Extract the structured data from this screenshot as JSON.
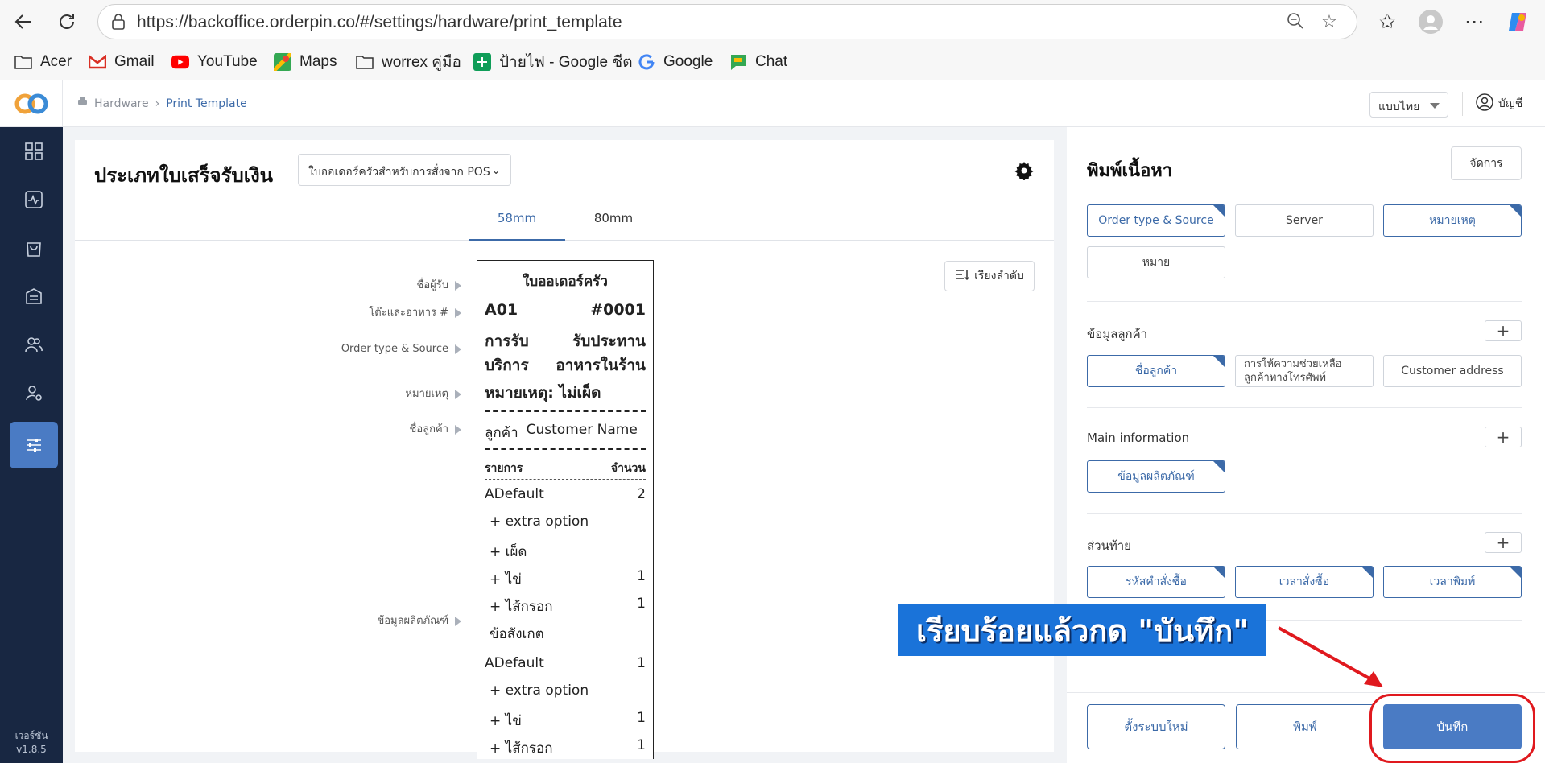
{
  "browser": {
    "url": "https://backoffice.orderpin.co/#/settings/hardware/print_template",
    "bookmarks": [
      "Acer",
      "Gmail",
      "YouTube",
      "Maps",
      "worrex คู่มือ",
      "ป้ายไฟ - Google ชีต",
      "Google",
      "Chat"
    ]
  },
  "header": {
    "breadcrumb": [
      "Hardware",
      "Print Template"
    ],
    "language": "แบบไทย",
    "account": "บัญชี"
  },
  "sidebar": {
    "icons": [
      "dashboard-icon",
      "activity-icon",
      "shopping-bag-icon",
      "store-icon",
      "users-icon",
      "user-settings-icon",
      "sliders-icon"
    ],
    "version_label": "เวอร์ชัน",
    "version": "v1.8.5"
  },
  "main": {
    "title": "ประเภทใบเสร็จรับเงิน",
    "type_select": "ใบออเดอร์ครัวสำหรับการสั่งจาก POS",
    "tabs": [
      "58mm",
      "80mm"
    ],
    "sort_label": "เรียงลำดับ",
    "row_labels": {
      "receiver": "ชื่อผู้รับ",
      "table": "โต๊ะและอาหาร #",
      "order_type": "Order type & Source",
      "note": "หมายเหตุ",
      "customer": "ชื่อลูกค้า",
      "product": "ข้อมูลผลิตภัณฑ์"
    },
    "receipt": {
      "title": "ใบออเดอร์ครัว",
      "table": "A01",
      "order_no": "#0001",
      "service_label": "การรับ",
      "service_label2": "บริการ",
      "service_value": "รับประทาน",
      "service_value2": "อาหารในร้าน",
      "note": "หมายเหตุ: ไม่เผ็ด",
      "customer_label": "ลูกค้า",
      "customer_value": "Customer Name",
      "col_item": "รายการ",
      "col_qty": "จำนวน",
      "lines": [
        {
          "name": "ADefault",
          "qty": "2"
        },
        {
          "name": "+ extra option",
          "qty": ""
        },
        {
          "name": "+ เผ็ด",
          "qty": ""
        },
        {
          "name": "+ ไข่",
          "qty": "1"
        },
        {
          "name": "+ ไส้กรอก",
          "qty": "1"
        },
        {
          "name": "ข้อสังเกต",
          "qty": ""
        },
        {
          "name": "ADefault",
          "qty": "1"
        },
        {
          "name": "+ extra option",
          "qty": ""
        },
        {
          "name": "+ ไข่",
          "qty": "1"
        },
        {
          "name": "+ ไส้กรอก",
          "qty": "1"
        }
      ]
    }
  },
  "right_panel": {
    "title": "พิมพ์เนื้อหา",
    "manage_label": "จัดการ",
    "content_chips": [
      "Order type & Source",
      "Server",
      "หมายเหตุ",
      "หมาย"
    ],
    "customer_section": "ข้อมูลลูกค้า",
    "customer_chips": [
      "ชื่อลูกค้า",
      "การให้ความช่วยเหลือลูกค้าทางโทรศัพท์",
      "Customer address"
    ],
    "main_section": "Main information",
    "main_chips": [
      "ข้อมูลผลิตภัณฑ์"
    ],
    "footer_section": "ส่วนท้าย",
    "footer_chips": [
      "รหัสคำสั่งซื้อ",
      "เวลาสั่งซื้อ",
      "เวลาพิมพ์"
    ],
    "reset_label": "ตั้งระบบใหม่",
    "print_label": "พิมพ์",
    "save_label": "บันทึก"
  },
  "annotation": "เรียบร้อยแล้วกด \"บันทึก\"",
  "colors": {
    "sidebar": "#182742",
    "accent": "#4a7bc4",
    "highlight": "#e0191e",
    "annotation_bg": "#1a73d9"
  }
}
